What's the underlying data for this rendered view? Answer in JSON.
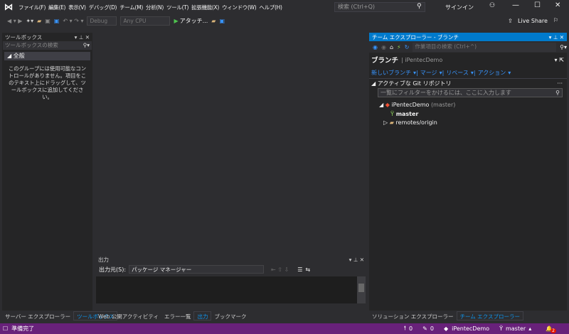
{
  "menu": {
    "items": [
      "ファイル(F)",
      "編集(E)",
      "表示(V)",
      "デバッグ(D)",
      "チーム(M)",
      "分析(N)",
      "ツール(T)",
      "拡張機能(X)",
      "ウィンドウ(W)",
      "ヘルプ(H)"
    ],
    "search_placeholder": "検索 (Ctrl+Q)",
    "signin": "サインイン"
  },
  "toolbar": {
    "config": "Debug",
    "platform": "Any CPU",
    "attach": "アタッチ...",
    "live_share": "Live Share"
  },
  "toolbox": {
    "title": "ツールボックス",
    "search_placeholder": "ツールボックスの検索",
    "group": "全般",
    "empty_message": "このグループには使用可能なコントロールがありません。項目をこのテキスト上にドラッグして、ツールボックスに追加してください。"
  },
  "team_explorer": {
    "title": "チーム エクスプローラー - ブランチ",
    "search_placeholder": "作業項目の検索 (Ctrl+^)",
    "page": "ブランチ",
    "repo_name": "iPentecDemo",
    "actions": [
      "新しいブランチ",
      "マージ",
      "リベース",
      "アクション"
    ],
    "section": "アクティブな Git リポジトリ",
    "filter_placeholder": "一覧にフィルターをかけるには、ここに入力します",
    "tree": {
      "repo": "iPentecDemo",
      "repo_branch": "(master)",
      "branch": "master",
      "remotes": "remotes/origin"
    }
  },
  "output": {
    "title": "出力",
    "source_label": "出力元(S):",
    "source_value": "パッケージ マネージャー"
  },
  "bottom_tabs": {
    "left": [
      "サーバー エクスプローラー",
      "ツールボックス"
    ],
    "center": [
      "Web 公開アクティビティ",
      "エラー一覧",
      "出力",
      "ブックマーク"
    ],
    "right": [
      "ソリューション エクスプローラー",
      "チーム エクスプローラー"
    ]
  },
  "status": {
    "text": "準備完了",
    "up": "0",
    "pencil": "0",
    "repo": "iPentecDemo",
    "branch": "master",
    "notifications": "2"
  },
  "colors": {
    "accent": "#007acc",
    "status": "#68217a"
  }
}
